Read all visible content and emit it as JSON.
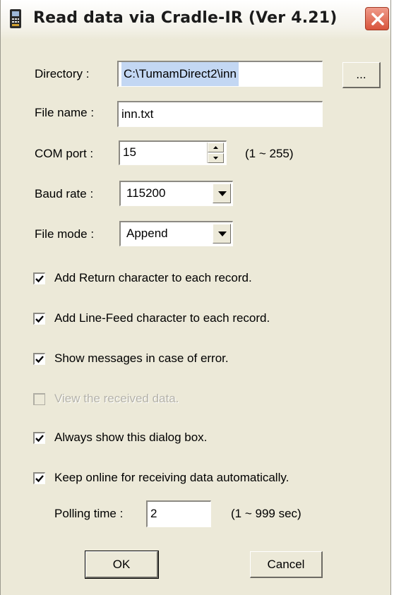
{
  "window": {
    "title": "Read data via Cradle-IR (Ver 4.21)",
    "icon": "cradle-device-icon",
    "close_icon": "close-icon"
  },
  "fields": {
    "directory": {
      "label": "Directory :",
      "value": "C:\\TumamDirect2\\inn",
      "browse_label": "..."
    },
    "file_name": {
      "label": "File name :",
      "value": "inn.txt"
    },
    "com_port": {
      "label": "COM port :",
      "value": "15",
      "range": "(1 ~ 255)"
    },
    "baud_rate": {
      "label": "Baud rate :",
      "value": "115200"
    },
    "file_mode": {
      "label": "File mode :",
      "value": "Append"
    }
  },
  "options": [
    {
      "label": "Add Return character to each record.",
      "checked": true,
      "enabled": true
    },
    {
      "label": "Add Line-Feed character to each record.",
      "checked": true,
      "enabled": true
    },
    {
      "label": "Show messages in case of error.",
      "checked": true,
      "enabled": true
    },
    {
      "label": "View the received data.",
      "checked": false,
      "enabled": false
    },
    {
      "label": "Always show this dialog box.",
      "checked": true,
      "enabled": true
    },
    {
      "label": "Keep online for receiving data automatically.",
      "checked": true,
      "enabled": true
    }
  ],
  "polling": {
    "label": "Polling time :",
    "value": "2",
    "range": "(1 ~ 999 sec)"
  },
  "buttons": {
    "ok": "OK",
    "cancel": "Cancel"
  },
  "colors": {
    "dialog_bg": "#ece9d8",
    "close_button": "#d8543c",
    "selection": "#c3d7f3"
  }
}
